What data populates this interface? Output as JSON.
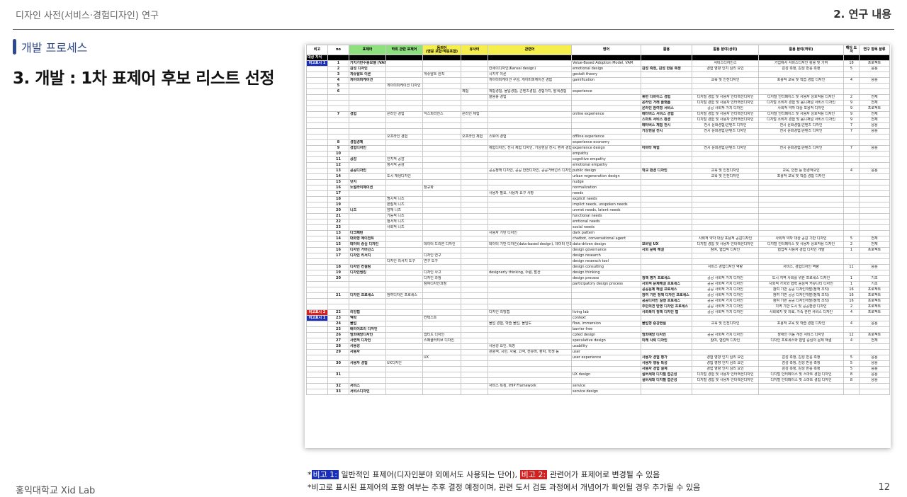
{
  "header": {
    "left": "디자인 사전(서비스·경험디자인) 연구",
    "right": "2. 연구 내용"
  },
  "section": "개발 프로세스",
  "title": "3. 개발 : 1차 표제어 후보 리스트 선정",
  "sheet": {
    "headers": [
      "비고",
      "no",
      "표제어",
      "하위 관련 표제어",
      "동의어",
      "(영문 포함·약문포함)",
      "유사어",
      "관련어",
      "영어",
      "활용",
      "활용 분야(상위)",
      "활용 분야(하위)",
      "해당 도서",
      "연구 항목 분류"
    ],
    "band": "대상 지식",
    "tags": {
      "b1": "비고표시 1",
      "b2": "비고표시 2"
    },
    "rows": [
      {
        "no": "1",
        "term": "가치기반수용모델 (VAM)",
        "sub": "",
        "syn": "",
        "sim": "",
        "rel": "",
        "eng": "Value-Based Adoption Model, VAM",
        "use": "",
        "top": "서비스디자인스",
        "low": "기업에서 서비스디자인 활용 및 기여",
        "cnt": "18",
        "cls": "프로젝트"
      },
      {
        "no": "2",
        "term": "감성 디자인",
        "sub": "",
        "syn": "",
        "sim": "",
        "rel": "칸세이디자인(Kansei design)",
        "eng": "emotional design",
        "use": "감성 측정, 감성 반응 측정",
        "top": "경험 영향 인지 심리 요인",
        "low": "감성 측정, 감성 반응 측정",
        "cnt": "5",
        "cls": "응용"
      },
      {
        "no": "3",
        "term": "게슈탈트 이론",
        "sub": "",
        "syn": "게슈탈트 원칙",
        "sim": "",
        "rel": "시지각 이론",
        "eng": "gestalt theory",
        "use": "",
        "top": "",
        "low": "",
        "cnt": "",
        "cls": ""
      },
      {
        "no": "4",
        "term": "게이미피케이션",
        "sub": "",
        "syn": "",
        "sim": "",
        "rel": "게이미피케이션 구성, 게이미피케이션 경험",
        "eng": "gamification",
        "use": "",
        "top": "교육 및 인천디자인",
        "low": "포용적 교육 및 학습 경험 디자인",
        "cnt": "4",
        "cls": "응용"
      },
      {
        "no": "5",
        "term": "",
        "sub": "게이미피케이션 디자인",
        "syn": "",
        "sim": "",
        "rel": "",
        "eng": "",
        "use": "",
        "top": "",
        "low": "",
        "cnt": "",
        "cls": ""
      },
      {
        "no": "6",
        "term": "",
        "sub": "",
        "syn": "",
        "sim": "체험",
        "rel": "체험경험, 물입경험, 콘텐츠경험, 경험가치, 탐색경험",
        "eng": "experience",
        "use": "",
        "top": "",
        "low": "",
        "cnt": "",
        "cls": ""
      },
      {
        "no": "",
        "term": "",
        "sub": "",
        "syn": "",
        "sim": "",
        "rel": "몰용용 경험",
        "eng": "",
        "use": "휴먼 디바이스 경험",
        "top": "디지털 경험 및 사용자 인터랙션디자인",
        "low": "디지털 인터페이스 및 사용자 상호작용 디자인",
        "cnt": "2",
        "cls": "전체"
      },
      {
        "no": "",
        "term": "",
        "sub": "",
        "syn": "",
        "sim": "",
        "rel": "",
        "eng": "",
        "use": "온라인 거래 플랫폼",
        "top": "디지털 경험 및 사용자 인터랙션디자인",
        "low": "디지털 소비자 경험 및 옴니채널 서비스 디자인",
        "cnt": "9",
        "cls": "전체"
      },
      {
        "no": "",
        "term": "",
        "sub": "",
        "syn": "",
        "sim": "",
        "rel": "",
        "eng": "",
        "use": "온라인 참여형 서비스",
        "top": "공공 사회적 가치 디자인",
        "low": "사회적 약자 대상 포용적 디자인",
        "cnt": "9",
        "cls": "프로젝트"
      },
      {
        "no": "7",
        "term": "경험",
        "sub": "온라인 경험",
        "syn": "익스피리언스",
        "sim": "온라인 체험",
        "rel": "",
        "eng": "online experience",
        "use": "메타버스 서비스 경험",
        "top": "디지털 경험 및 사용자 인터랙션디자인",
        "low": "디지털 인터페이스 및 사용자 상호작용 디자인",
        "cnt": "9",
        "cls": "전체"
      },
      {
        "no": "",
        "term": "",
        "sub": "",
        "syn": "",
        "sim": "",
        "rel": "",
        "eng": "",
        "use": "스마트 서비스 환경",
        "top": "디지털 경험 및 사용자 인터랙션디자인",
        "low": "디지털 소비자 경험 및 옴니채널 서비스 디자인",
        "cnt": "9",
        "cls": "전체"
      },
      {
        "no": "",
        "term": "",
        "sub": "",
        "syn": "",
        "sim": "",
        "rel": "",
        "eng": "",
        "use": "메타버스 체험 전시",
        "top": "전시 문화경험/콘텐츠 디자인",
        "low": "전시 문화경험/콘텐츠 디자인",
        "cnt": "7",
        "cls": "응용"
      },
      {
        "no": "",
        "term": "",
        "sub": "",
        "syn": "",
        "sim": "",
        "rel": "",
        "eng": "",
        "use": "가상현실 전시",
        "top": "전시 문화경험/콘텐츠 디자인",
        "low": "전시 문화경험/콘텐츠 디자인",
        "cnt": "7",
        "cls": "응용"
      },
      {
        "no": "",
        "term": "",
        "sub": "오프라인 경험",
        "syn": "",
        "sim": "오프라인 체험",
        "rel": "스토어 경험",
        "eng": "offline experience",
        "use": "",
        "top": "",
        "low": "",
        "cnt": "",
        "cls": ""
      },
      {
        "no": "8",
        "term": "경험경제",
        "sub": "",
        "syn": "",
        "sim": "",
        "rel": "",
        "eng": "experience economy",
        "use": "",
        "top": "",
        "low": "",
        "cnt": "",
        "cls": ""
      },
      {
        "no": "9",
        "term": "경험디자인",
        "sub": "",
        "syn": "",
        "sim": "",
        "rel": "체험디자인, 전시 체험 디자인, 가상현실 전시, 환자 경험 디자인",
        "eng": "experience design",
        "use": "아바타 체험",
        "top": "전시 문화경험/콘텐츠 디자인",
        "low": "전시 문화경험/콘텐츠 디자인",
        "cnt": "7",
        "cls": "응용"
      },
      {
        "no": "10",
        "term": "",
        "sub": "",
        "syn": "",
        "sim": "",
        "rel": "",
        "eng": "empathy",
        "use": "",
        "top": "",
        "low": "",
        "cnt": "",
        "cls": ""
      },
      {
        "no": "11",
        "term": "공감",
        "sub": "인지적 공감",
        "syn": "",
        "sim": "",
        "rel": "",
        "eng": "cognitive empathy",
        "use": "",
        "top": "",
        "low": "",
        "cnt": "",
        "cls": ""
      },
      {
        "no": "12",
        "term": "",
        "sub": "정서적 공감",
        "syn": "",
        "sim": "",
        "rel": "",
        "eng": "emotional empathy",
        "use": "",
        "top": "",
        "low": "",
        "cnt": "",
        "cls": ""
      },
      {
        "no": "13",
        "term": "공공디자인",
        "sub": "",
        "syn": "",
        "sim": "",
        "rel": "공공정책 디자인, 공공 안전디자인, 공공거버넌스 디자인, 사회문제 해결 디자인 이외 영역 다루는 디",
        "eng": "public design",
        "use": "학교 환경 디자인",
        "top": "교육 및 인천디자인",
        "low": "교육, 안전 등 환경적요인",
        "cnt": "4",
        "cls": "응용"
      },
      {
        "no": "14",
        "term": "",
        "sub": "도시 재생디자인",
        "syn": "",
        "sim": "",
        "rel": "",
        "eng": "urban regeneration design",
        "use": "",
        "top": "교육 및 인천디자인",
        "low": "포용적 교육 및 학습 경험 디자인",
        "cnt": "",
        "cls": ""
      },
      {
        "no": "15",
        "term": "넛지",
        "sub": "",
        "syn": "",
        "sim": "",
        "rel": "",
        "eng": "nudge",
        "use": "",
        "top": "",
        "low": "",
        "cnt": "",
        "cls": ""
      },
      {
        "no": "16",
        "term": "노멀라이제이션",
        "sub": "",
        "syn": "정규화",
        "sim": "",
        "rel": "",
        "eng": "normalization",
        "use": "",
        "top": "",
        "low": "",
        "cnt": "",
        "cls": ""
      },
      {
        "no": "17",
        "term": "",
        "sub": "",
        "syn": "",
        "sim": "",
        "rel": "사용자 필요, 사용자 요구 사항",
        "eng": "needs",
        "use": "",
        "top": "",
        "low": "",
        "cnt": "",
        "cls": ""
      },
      {
        "no": "18",
        "term": "",
        "sub": "명시적 니즈",
        "syn": "",
        "sim": "",
        "rel": "",
        "eng": "explicit needs",
        "use": "",
        "top": "",
        "low": "",
        "cnt": "",
        "cls": ""
      },
      {
        "no": "19",
        "term": "",
        "sub": "본질적 니즈",
        "syn": "",
        "sim": "",
        "rel": "",
        "eng": "implict needs, unspoken needs",
        "use": "",
        "top": "",
        "low": "",
        "cnt": "",
        "cls": ""
      },
      {
        "no": "20",
        "term": "니즈",
        "sub": "잠재 니즈",
        "syn": "",
        "sim": "",
        "rel": "",
        "eng": "unmet needs, latent needs",
        "use": "",
        "top": "",
        "low": "",
        "cnt": "",
        "cls": ""
      },
      {
        "no": "21",
        "term": "",
        "sub": "기능적 니즈",
        "syn": "",
        "sim": "",
        "rel": "",
        "eng": "functional needs",
        "use": "",
        "top": "",
        "low": "",
        "cnt": "",
        "cls": ""
      },
      {
        "no": "22",
        "term": "",
        "sub": "정서적 니즈",
        "syn": "",
        "sim": "",
        "rel": "",
        "eng": "emtional needs",
        "use": "",
        "top": "",
        "low": "",
        "cnt": "",
        "cls": ""
      },
      {
        "no": "23",
        "term": "",
        "sub": "사회적 니즈",
        "syn": "",
        "sim": "",
        "rel": "",
        "eng": "social needs",
        "use": "",
        "top": "",
        "low": "",
        "cnt": "",
        "cls": ""
      },
      {
        "no": "13",
        "term": "다크패턴",
        "sub": "",
        "syn": "",
        "sim": "",
        "rel": "사용자 기만 디자인",
        "eng": "dark pattern",
        "use": "",
        "top": "",
        "low": "",
        "cnt": "",
        "cls": ""
      },
      {
        "no": "14",
        "term": "대화형 에이전트",
        "sub": "",
        "syn": "",
        "sim": "",
        "rel": "",
        "eng": "chatbot, conversational agent",
        "use": "",
        "top": "사회적 약자 대상 포용적 공감디자인",
        "low": "사회적 약자 대상 공감 기반 디자인",
        "cnt": "5",
        "cls": "전체"
      },
      {
        "no": "15",
        "term": "데이터 중심 디자인",
        "sub": "",
        "syn": "데이터 드리븐 디자인",
        "sim": "",
        "rel": "데이터 기반 디자인(data-based design), 데이터 인포드 디자인(data-informed design)",
        "eng": "data-driven design",
        "use": "모바일 UX",
        "top": "디지털 경험 및 사용자 인터랙션디자인",
        "low": "디지털 인터페이스 및 사용자 상호작용 디자인",
        "cnt": "2",
        "cls": "전체"
      },
      {
        "no": "16",
        "term": "디자인 거버넌스",
        "sub": "",
        "syn": "",
        "sim": "",
        "rel": "",
        "eng": "design governance",
        "use": "사회 문제 해결",
        "top": "참여, 협업적 디자인",
        "low": "협업적 사용자 경험 디자인 개발",
        "cnt": "1",
        "cls": "프로젝트"
      },
      {
        "no": "17",
        "term": "디자인 리서치",
        "sub": "",
        "syn": "디자인 연구",
        "sim": "",
        "rel": "",
        "eng": "design research",
        "use": "",
        "top": "",
        "low": "",
        "cnt": "",
        "cls": ""
      },
      {
        "no": "",
        "term": "",
        "sub": "디자인 리서치 도구",
        "syn": "연구 도구",
        "sim": "",
        "rel": "",
        "eng": "design reserach tool",
        "use": "",
        "top": "",
        "low": "",
        "cnt": "",
        "cls": ""
      },
      {
        "no": "18",
        "term": "디자인 컨설팅",
        "sub": "",
        "syn": "",
        "sim": "",
        "rel": "",
        "eng": "design consulting",
        "use": "",
        "top": "서비스 경험디자인 역량",
        "low": "서비스, 경험디자인 역량",
        "cnt": "11",
        "cls": "응용"
      },
      {
        "no": "19",
        "term": "디자인씽킹",
        "sub": "",
        "syn": "디자인 사고",
        "sim": "",
        "rel": "designerly thinking, 수렴, 발산",
        "eng": "design thinking",
        "use": "",
        "top": "",
        "low": "",
        "cnt": "",
        "cls": ""
      },
      {
        "no": "20",
        "term": "",
        "sub": "",
        "syn": "디자인 과정",
        "sim": "",
        "rel": "",
        "eng": "design process",
        "use": "정책 평가 프로세스",
        "top": "공공 사회적 가치 디자인",
        "low": "도시 지역 사회를 위한 프로세스 디자인",
        "cnt": "1",
        "cls": "기초"
      },
      {
        "no": "",
        "term": "",
        "sub": "",
        "syn": "참여디자인과정",
        "sim": "",
        "rel": "",
        "eng": "participatory design process",
        "use": "사회적 문제해결 프로세스",
        "top": "공공 사회적 가치 디자인",
        "low": "사회적 가치와 협력 중심적 커뮤니티 디자인",
        "cnt": "1",
        "cls": "기초"
      },
      {
        "no": "",
        "term": "",
        "sub": "",
        "syn": "",
        "sim": "",
        "rel": "",
        "eng": "",
        "use": "공공문제 해결 프로세스",
        "top": "공공 사회적 가치 디자인",
        "low": "참여 기반 공공 디자인개발(정책 조직)",
        "cnt": "16",
        "cls": "프로젝트"
      },
      {
        "no": "21",
        "term": "디자인 프로세스",
        "sub": "참여디자인 프로세스",
        "syn": "",
        "sim": "",
        "rel": "",
        "eng": "",
        "use": "참여 기반 정책 디자인 프로세스",
        "top": "공공 사회적 가치 디자인",
        "low": "참여 기반 공공 디자인개발(정책 조직)",
        "cnt": "16",
        "cls": "프로젝트"
      },
      {
        "no": "",
        "term": "",
        "sub": "",
        "syn": "",
        "sim": "",
        "rel": "",
        "eng": "",
        "use": "공공디자인 실행 프로세스",
        "top": "공공 사회적 가치 디자인",
        "low": "참여 기반 공공 디자인개발(정책 조직)",
        "cnt": "16",
        "cls": "프로젝트"
      },
      {
        "no": "",
        "term": "",
        "sub": "",
        "syn": "",
        "sim": "",
        "rel": "",
        "eng": "",
        "use": "주민의견 반영 디자인 프로세스",
        "top": "공공 사회적 가치 디자인",
        "low": "지역 기반 도시 및 공공환경 디자인",
        "cnt": "2",
        "cls": "프로젝트"
      },
      {
        "no": "22",
        "term": "리빙랩",
        "sub": "",
        "syn": "",
        "sim": "",
        "rel": "디자인 리빙랩",
        "eng": "living lab",
        "use": "사회복지 정책 디자인 랩",
        "top": "공공 사회적 가치 디자인",
        "low": "사회복지 및 의료, 가족 관련 서비스 디자인",
        "cnt": "4",
        "cls": "프로젝트",
        "tag": "b2"
      },
      {
        "no": "23",
        "term": "맥락",
        "sub": "",
        "syn": "컨텍스트",
        "sim": "",
        "rel": "",
        "eng": "context",
        "use": "",
        "top": "",
        "low": "",
        "cnt": "",
        "cls": "",
        "tag": "b1"
      },
      {
        "no": "24",
        "term": "몰입",
        "sub": "",
        "syn": "",
        "sim": "",
        "rel": "몰입 경험, 학습 몰입, 몰입도",
        "eng": "flow, immersion",
        "use": "몰입형 증강현실",
        "top": "교육 및 인천디자인",
        "low": "포용적 교육 및 학습 경험 디자인",
        "cnt": "4",
        "cls": "응용"
      },
      {
        "no": "25",
        "term": "배리어프리 디자인",
        "sub": "",
        "syn": "",
        "sim": "",
        "rel": "",
        "eng": "barrier free",
        "use": "",
        "top": "",
        "low": "",
        "cnt": "",
        "cls": ""
      },
      {
        "no": "26",
        "term": "범죄예방디자인",
        "sub": "",
        "syn": "셉티드 디자인",
        "sim": "",
        "rel": "",
        "eng": "cpted design",
        "use": "범죄예방 디자인",
        "top": "공공 사회적 가치 디자인",
        "low": "장애인 이동 개선 서비스 디자인",
        "cnt": "12",
        "cls": "프로젝트"
      },
      {
        "no": "27",
        "term": "사변적 디자인",
        "sub": "",
        "syn": "스페큘러티브 디자인",
        "sim": "",
        "rel": "",
        "eng": "speculative design",
        "use": "미래 사회 디자인",
        "top": "참여, 협업적 디자인",
        "low": "디자인 프로세스와 협업 중심의 문제 해결",
        "cnt": "4",
        "cls": "전체"
      },
      {
        "no": "28",
        "term": "사용성",
        "sub": "",
        "syn": "",
        "sim": "",
        "rel": "사용성 요인, 특징",
        "eng": "usability",
        "use": "",
        "top": "",
        "low": "",
        "cnt": "",
        "cls": ""
      },
      {
        "no": "29",
        "term": "사용자",
        "sub": "",
        "syn": "",
        "sim": "",
        "rel": "관광객, 시민, 사람, 고객, 컨슈머, 환자, 학생 등",
        "eng": "user",
        "use": "",
        "top": "",
        "low": "",
        "cnt": "",
        "cls": ""
      },
      {
        "no": "",
        "term": "",
        "sub": "",
        "syn": "UX",
        "sim": "",
        "rel": "",
        "eng": "user experience",
        "use": "사용자 경험 평가",
        "top": "경험 영향 인지 심리 요인",
        "low": "감성 측정, 감성 반응 측정",
        "cnt": "5",
        "cls": "응용"
      },
      {
        "no": "30",
        "term": "사용자 경험",
        "sub": "UX디자인",
        "syn": "",
        "sim": "",
        "rel": "",
        "eng": "",
        "use": "사용자 행동 특성",
        "top": "경험 영향 인지 심리 요인",
        "low": "감성 측정, 감성 반응 측정",
        "cnt": "5",
        "cls": "응용"
      },
      {
        "no": "",
        "term": "",
        "sub": "",
        "syn": "",
        "sim": "",
        "rel": "",
        "eng": "",
        "use": "사용자 경험 설계",
        "top": "경험 영향 인지 심리 요인",
        "low": "감성 측정, 감성 반응 측정",
        "cnt": "5",
        "cls": "응용"
      },
      {
        "no": "31",
        "term": "",
        "sub": "",
        "syn": "",
        "sim": "",
        "rel": "",
        "eng": "UX design",
        "use": "실버세대 디지털 접근성",
        "top": "디지털 경험 및 사용자 인터랙션디자인",
        "low": "디지털 인터페이스 및 스마트 경험 디자인",
        "cnt": "8",
        "cls": "응용"
      },
      {
        "no": "",
        "term": "",
        "sub": "",
        "syn": "",
        "sim": "",
        "rel": "",
        "eng": "",
        "use": "실버세대 디지털 접근성",
        "top": "디지털 경험 및 사용자 인터랙션디자인",
        "low": "디지털 인터페이스 및 스마트 경험 디자인",
        "cnt": "8",
        "cls": "응용"
      },
      {
        "no": "32",
        "term": "서비스",
        "sub": "",
        "syn": "",
        "sim": "",
        "rel": "서비스 특징, IHIP Framework",
        "eng": "service",
        "use": "",
        "top": "",
        "low": "",
        "cnt": "",
        "cls": ""
      },
      {
        "no": "33",
        "term": "서비스디자인",
        "sub": "",
        "syn": "",
        "sim": "",
        "rel": "",
        "eng": "service design",
        "use": "",
        "top": "",
        "low": "",
        "cnt": "",
        "cls": ""
      }
    ]
  },
  "footnotes": {
    "n1_star": "*",
    "n1_tag1": "비고 1:",
    "n1_text1": " 일반적인 표제어(디자인분야 외에서도 사용되는 단어), ",
    "n1_tag2": "비고 2:",
    "n1_text2": " 관련어가 표제어로 변경될 수 있음",
    "n2": "*비고로 표시된 표제어의 포함 여부는 추후 결정 예정이며, 관련 도서 검토 과정에서 개념어가 확인될 경우 추가될 수 있음"
  },
  "footer": {
    "org": "홍익대학교 Xid Lab",
    "page": "12"
  }
}
